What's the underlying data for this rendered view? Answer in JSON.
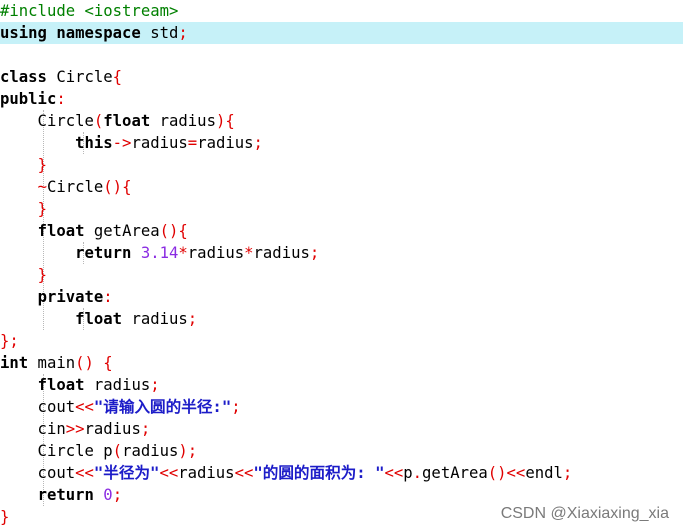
{
  "code_lines": [
    {
      "tokens": [
        {
          "t": "#include <iostream>",
          "k": "pp"
        }
      ]
    },
    {
      "highlighted": true,
      "tokens": [
        {
          "t": "using namespace",
          "k": "kw"
        },
        {
          "t": " std",
          "k": "plain"
        },
        {
          "t": ";",
          "k": "op"
        }
      ]
    },
    {
      "tokens": []
    },
    {
      "tokens": [
        {
          "t": "class",
          "k": "kw"
        },
        {
          "t": " Circle",
          "k": "plain"
        },
        {
          "t": "{",
          "k": "op"
        }
      ]
    },
    {
      "tokens": [
        {
          "t": "public",
          "k": "kw"
        },
        {
          "t": ":",
          "k": "op"
        }
      ]
    },
    {
      "tokens": [
        {
          "t": "    Circle",
          "k": "plain"
        },
        {
          "t": "(",
          "k": "op"
        },
        {
          "t": "float",
          "k": "kw"
        },
        {
          "t": " radius",
          "k": "plain"
        },
        {
          "t": "){",
          "k": "op"
        }
      ]
    },
    {
      "tokens": [
        {
          "t": "        ",
          "k": "plain"
        },
        {
          "t": "this",
          "k": "kw"
        },
        {
          "t": "->",
          "k": "op"
        },
        {
          "t": "radius",
          "k": "plain"
        },
        {
          "t": "=",
          "k": "op"
        },
        {
          "t": "radius",
          "k": "plain"
        },
        {
          "t": ";",
          "k": "op"
        }
      ]
    },
    {
      "tokens": [
        {
          "t": "    ",
          "k": "plain"
        },
        {
          "t": "}",
          "k": "op"
        }
      ]
    },
    {
      "tokens": [
        {
          "t": "    ",
          "k": "plain"
        },
        {
          "t": "~",
          "k": "op"
        },
        {
          "t": "Circle",
          "k": "plain"
        },
        {
          "t": "(){",
          "k": "op"
        }
      ]
    },
    {
      "tokens": [
        {
          "t": "    ",
          "k": "plain"
        },
        {
          "t": "}",
          "k": "op"
        }
      ]
    },
    {
      "tokens": [
        {
          "t": "    ",
          "k": "plain"
        },
        {
          "t": "float",
          "k": "kw"
        },
        {
          "t": " getArea",
          "k": "plain"
        },
        {
          "t": "(){",
          "k": "op"
        }
      ]
    },
    {
      "tokens": [
        {
          "t": "        ",
          "k": "plain"
        },
        {
          "t": "return",
          "k": "kw"
        },
        {
          "t": " ",
          "k": "plain"
        },
        {
          "t": "3.14",
          "k": "num"
        },
        {
          "t": "*",
          "k": "op"
        },
        {
          "t": "radius",
          "k": "plain"
        },
        {
          "t": "*",
          "k": "op"
        },
        {
          "t": "radius",
          "k": "plain"
        },
        {
          "t": ";",
          "k": "op"
        }
      ]
    },
    {
      "tokens": [
        {
          "t": "    ",
          "k": "plain"
        },
        {
          "t": "}",
          "k": "op"
        }
      ]
    },
    {
      "tokens": [
        {
          "t": "    ",
          "k": "plain"
        },
        {
          "t": "private",
          "k": "kw"
        },
        {
          "t": ":",
          "k": "op"
        }
      ]
    },
    {
      "tokens": [
        {
          "t": "        ",
          "k": "plain"
        },
        {
          "t": "float",
          "k": "kw"
        },
        {
          "t": " radius",
          "k": "plain"
        },
        {
          "t": ";",
          "k": "op"
        }
      ]
    },
    {
      "tokens": [
        {
          "t": "};",
          "k": "op"
        }
      ]
    },
    {
      "tokens": [
        {
          "t": "int",
          "k": "kw"
        },
        {
          "t": " main",
          "k": "plain"
        },
        {
          "t": "() {",
          "k": "op"
        }
      ]
    },
    {
      "tokens": [
        {
          "t": "    ",
          "k": "plain"
        },
        {
          "t": "float",
          "k": "kw"
        },
        {
          "t": " radius",
          "k": "plain"
        },
        {
          "t": ";",
          "k": "op"
        }
      ]
    },
    {
      "tokens": [
        {
          "t": "    cout",
          "k": "plain"
        },
        {
          "t": "<<",
          "k": "op"
        },
        {
          "t": "\"请输入圆的半径:\"",
          "k": "str"
        },
        {
          "t": ";",
          "k": "op"
        }
      ]
    },
    {
      "tokens": [
        {
          "t": "    cin",
          "k": "plain"
        },
        {
          "t": ">>",
          "k": "op"
        },
        {
          "t": "radius",
          "k": "plain"
        },
        {
          "t": ";",
          "k": "op"
        }
      ]
    },
    {
      "tokens": [
        {
          "t": "    Circle p",
          "k": "plain"
        },
        {
          "t": "(",
          "k": "op"
        },
        {
          "t": "radius",
          "k": "plain"
        },
        {
          "t": ");",
          "k": "op"
        }
      ]
    },
    {
      "tokens": [
        {
          "t": "    cout",
          "k": "plain"
        },
        {
          "t": "<<",
          "k": "op"
        },
        {
          "t": "\"半径为\"",
          "k": "str"
        },
        {
          "t": "<<",
          "k": "op"
        },
        {
          "t": "radius",
          "k": "plain"
        },
        {
          "t": "<<",
          "k": "op"
        },
        {
          "t": "\"的圆的面积为: \"",
          "k": "str"
        },
        {
          "t": "<<",
          "k": "op"
        },
        {
          "t": "p",
          "k": "plain"
        },
        {
          "t": ".",
          "k": "op"
        },
        {
          "t": "getArea",
          "k": "plain"
        },
        {
          "t": "()",
          "k": "op"
        },
        {
          "t": "<<",
          "k": "op"
        },
        {
          "t": "endl",
          "k": "plain"
        },
        {
          "t": ";",
          "k": "op"
        }
      ]
    },
    {
      "tokens": [
        {
          "t": "    ",
          "k": "plain"
        },
        {
          "t": "return",
          "k": "kw"
        },
        {
          "t": " ",
          "k": "plain"
        },
        {
          "t": "0",
          "k": "num"
        },
        {
          "t": ";",
          "k": "op"
        }
      ]
    },
    {
      "tokens": [
        {
          "t": "}",
          "k": "op"
        }
      ]
    }
  ],
  "watermark": "CSDN @Xiaxiaxing_xia"
}
